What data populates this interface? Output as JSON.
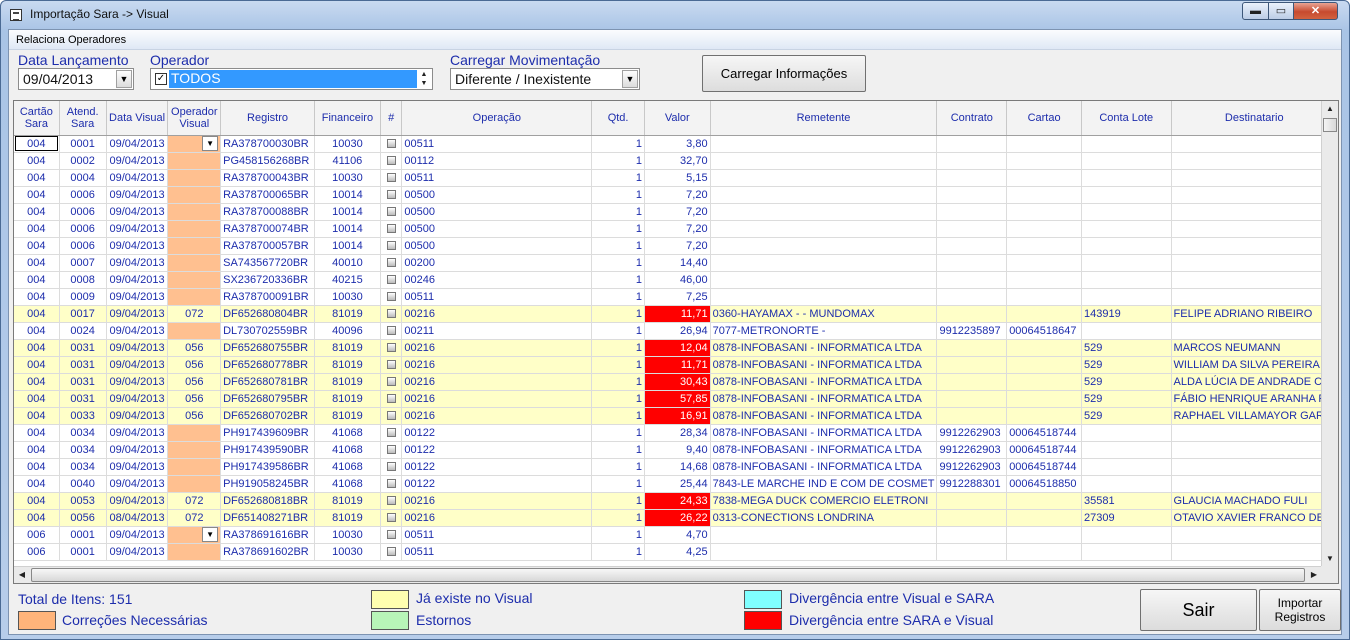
{
  "window": {
    "title": "Importação Sara -> Visual",
    "min_label": "▬",
    "max_label": "▭",
    "close_label": "✕"
  },
  "menu": {
    "item": "Relaciona Operadores"
  },
  "filters": {
    "data_label": "Data Lançamento",
    "data_value": "09/04/2013",
    "operador_label": "Operador",
    "operador_value": "TODOS",
    "carregar_label": "Carregar Movimentação",
    "carregar_value": "Diferente / Inexistente",
    "carregar_button": "Carregar Informações"
  },
  "grid": {
    "columns": [
      "Cartão Sara",
      "Atend. Sara",
      "Data Visual",
      "Operador Visual",
      "Registro",
      "Financeiro",
      "#",
      "Operação",
      "Qtd.",
      "Valor",
      "Remetente",
      "Contrato",
      "Cartao",
      "Conta Lote",
      "Destinatario"
    ],
    "rows": [
      [
        "004",
        "0001",
        "09/04/2013",
        "",
        "RA378700030BR",
        "10030",
        "00511",
        "1",
        "3,80",
        "",
        "",
        "",
        "",
        ""
      ],
      [
        "004",
        "0002",
        "09/04/2013",
        "",
        "PG458156268BR",
        "41106",
        "00112",
        "1",
        "32,70",
        "",
        "",
        "",
        "",
        ""
      ],
      [
        "004",
        "0004",
        "09/04/2013",
        "",
        "RA378700043BR",
        "10030",
        "00511",
        "1",
        "5,15",
        "",
        "",
        "",
        "",
        ""
      ],
      [
        "004",
        "0006",
        "09/04/2013",
        "",
        "RA378700065BR",
        "10014",
        "00500",
        "1",
        "7,20",
        "",
        "",
        "",
        "",
        ""
      ],
      [
        "004",
        "0006",
        "09/04/2013",
        "",
        "RA378700088BR",
        "10014",
        "00500",
        "1",
        "7,20",
        "",
        "",
        "",
        "",
        ""
      ],
      [
        "004",
        "0006",
        "09/04/2013",
        "",
        "RA378700074BR",
        "10014",
        "00500",
        "1",
        "7,20",
        "",
        "",
        "",
        "",
        ""
      ],
      [
        "004",
        "0006",
        "09/04/2013",
        "",
        "RA378700057BR",
        "10014",
        "00500",
        "1",
        "7,20",
        "",
        "",
        "",
        "",
        ""
      ],
      [
        "004",
        "0007",
        "09/04/2013",
        "",
        "SA743567720BR",
        "40010",
        "00200",
        "1",
        "14,40",
        "",
        "",
        "",
        "",
        ""
      ],
      [
        "004",
        "0008",
        "09/04/2013",
        "",
        "SX236720336BR",
        "40215",
        "00246",
        "1",
        "46,00",
        "",
        "",
        "",
        "",
        ""
      ],
      [
        "004",
        "0009",
        "09/04/2013",
        "",
        "RA378700091BR",
        "10030",
        "00511",
        "1",
        "7,25",
        "",
        "",
        "",
        "",
        ""
      ],
      [
        "004",
        "0017",
        "09/04/2013",
        "072",
        "DF652680804BR",
        "81019",
        "00216",
        "1",
        "11,71",
        "0360-HAYAMAX   - - MUNDOMAX",
        "",
        "",
        "143919",
        "FELIPE ADRIANO RIBEIRO"
      ],
      [
        "004",
        "0024",
        "09/04/2013",
        "",
        "DL730702559BR",
        "40096",
        "00211",
        "1",
        "26,94",
        "7077-METRONORTE   -",
        "9912235897",
        "00064518647",
        "",
        ""
      ],
      [
        "004",
        "0031",
        "09/04/2013",
        "056",
        "DF652680755BR",
        "81019",
        "00216",
        "1",
        "12,04",
        "0878-INFOBASANI - INFORMATICA LTDA",
        "",
        "",
        "529",
        "MARCOS NEUMANN"
      ],
      [
        "004",
        "0031",
        "09/04/2013",
        "056",
        "DF652680778BR",
        "81019",
        "00216",
        "1",
        "11,71",
        "0878-INFOBASANI - INFORMATICA LTDA",
        "",
        "",
        "529",
        "WILLIAM DA SILVA PEREIRA"
      ],
      [
        "004",
        "0031",
        "09/04/2013",
        "056",
        "DF652680781BR",
        "81019",
        "00216",
        "1",
        "30,43",
        "0878-INFOBASANI - INFORMATICA LTDA",
        "",
        "",
        "529",
        "ALDA LÚCIA DE ANDRADE CO"
      ],
      [
        "004",
        "0031",
        "09/04/2013",
        "056",
        "DF652680795BR",
        "81019",
        "00216",
        "1",
        "57,85",
        "0878-INFOBASANI - INFORMATICA LTDA",
        "",
        "",
        "529",
        "FÁBIO HENRIQUE ARANHA RE"
      ],
      [
        "004",
        "0033",
        "09/04/2013",
        "056",
        "DF652680702BR",
        "81019",
        "00216",
        "1",
        "16,91",
        "0878-INFOBASANI - INFORMATICA LTDA",
        "",
        "",
        "529",
        "RAPHAEL VILLAMAYOR GARU"
      ],
      [
        "004",
        "0034",
        "09/04/2013",
        "",
        "PH917439609BR",
        "41068",
        "00122",
        "1",
        "28,34",
        "0878-INFOBASANI - INFORMATICA LTDA",
        "9912262903",
        "00064518744",
        "",
        ""
      ],
      [
        "004",
        "0034",
        "09/04/2013",
        "",
        "PH917439590BR",
        "41068",
        "00122",
        "1",
        "9,40",
        "0878-INFOBASANI - INFORMATICA LTDA",
        "9912262903",
        "00064518744",
        "",
        ""
      ],
      [
        "004",
        "0034",
        "09/04/2013",
        "",
        "PH917439586BR",
        "41068",
        "00122",
        "1",
        "14,68",
        "0878-INFOBASANI - INFORMATICA LTDA",
        "9912262903",
        "00064518744",
        "",
        ""
      ],
      [
        "004",
        "0040",
        "09/04/2013",
        "",
        "PH919058245BR",
        "41068",
        "00122",
        "1",
        "25,44",
        "7843-LE MARCHE IND E COM DE COSMET",
        "9912288301",
        "00064518850",
        "",
        ""
      ],
      [
        "004",
        "0053",
        "09/04/2013",
        "072",
        "DF652680818BR",
        "81019",
        "00216",
        "1",
        "24,33",
        "7838-MEGA DUCK COMERCIO ELETRONI",
        "",
        "",
        "35581",
        "GLAUCIA MACHADO FULI"
      ],
      [
        "004",
        "0056",
        "08/04/2013",
        "072",
        "DF651408271BR",
        "81019",
        "00216",
        "1",
        "26,22",
        "0313-CONECTIONS LONDRINA",
        "",
        "",
        "27309",
        "OTAVIO XAVIER FRANCO DE C"
      ],
      [
        "006",
        "0001",
        "09/04/2013",
        "",
        "RA378691616BR",
        "10030",
        "00511",
        "1",
        "4,70",
        "",
        "",
        "",
        "",
        ""
      ],
      [
        "006",
        "0001",
        "09/04/2013",
        "",
        "RA378691602BR",
        "10030",
        "00511",
        "1",
        "4,25",
        "",
        "",
        "",
        "",
        ""
      ]
    ],
    "row_styles": [
      "o",
      "o",
      "o",
      "o",
      "o",
      "o",
      "o",
      "o",
      "o",
      "o",
      "yr",
      "w",
      "yr",
      "yr",
      "yr",
      "yr",
      "yr",
      "o",
      "o",
      "o",
      "o",
      "yr",
      "yr",
      "o",
      "o"
    ]
  },
  "footer": {
    "total_label": "Total de Itens: 151",
    "legend": [
      {
        "label": "Correções Necessárias",
        "color": "#ffb47a"
      },
      {
        "label": "Já existe no Visual",
        "color": "#ffffb0"
      },
      {
        "label": "Estornos",
        "color": "#b8f5b8"
      },
      {
        "label": "Divergência entre Visual e SARA",
        "color": "#80ffff"
      },
      {
        "label": "Divergência entre SARA e Visual",
        "color": "#ff0000"
      }
    ],
    "sair_button": "Sair",
    "importar_button": "Importar Registros"
  }
}
